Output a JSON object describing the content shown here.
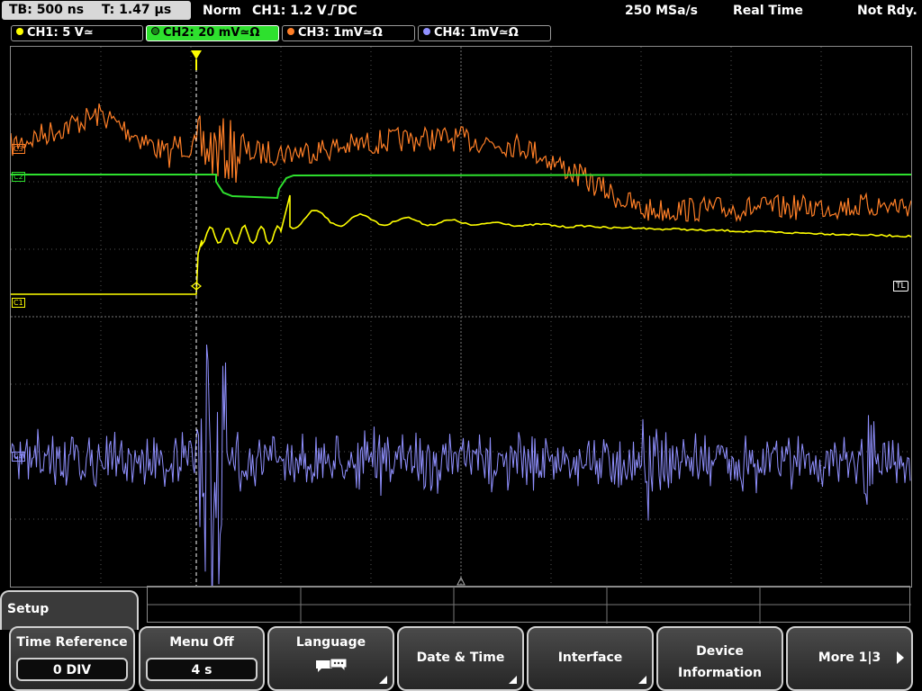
{
  "status_bar": {
    "timebase": "TB: 500 ns",
    "trigger_time": "T: 1.47 µs",
    "mode": "Norm",
    "trigger_source": "CH1: 1.2 V",
    "trigger_slope_icon": "rising-edge-icon",
    "coupling": "DC",
    "sample_rate": "250 MSa/s",
    "acq_mode": "Real Time",
    "ready_state": "Not Rdy."
  },
  "channels": [
    {
      "label": "CH1: 5 V",
      "suffix": "≃",
      "color": "#ffff00",
      "active": false
    },
    {
      "label": "CH2: 20 mV",
      "suffix": "≃Ω",
      "color": "#2ee02e",
      "active": true
    },
    {
      "label": "CH3: 1mV",
      "suffix": "≃Ω",
      "color": "#ff7f27",
      "active": false
    },
    {
      "label": "CH4: 1mV",
      "suffix": "≃Ω",
      "color": "#9090ff",
      "active": false
    }
  ],
  "markers": {
    "ch3": "C3",
    "ch2": "C2",
    "ch1": "C1",
    "ch4": "C4",
    "trigger_level": "TL",
    "trigger_pos_icon": "trigger-position-icon"
  },
  "menu": {
    "title": "Setup",
    "softkeys": [
      {
        "label": "Time Reference",
        "value": "0 DIV"
      },
      {
        "label": "Menu Off",
        "value": "4 s"
      },
      {
        "label": "Language",
        "icon": "speech-bubbles-icon"
      },
      {
        "label": "Date & Time"
      },
      {
        "label": "Interface"
      },
      {
        "label_line1": "Device",
        "label_line2": "Information"
      },
      {
        "label": "More 1|3"
      }
    ]
  },
  "colors": {
    "ch1": "#ffff00",
    "ch2": "#2ee02e",
    "ch3": "#ff7f27",
    "ch4": "#9090ff",
    "grid": "#8a8a8a"
  }
}
